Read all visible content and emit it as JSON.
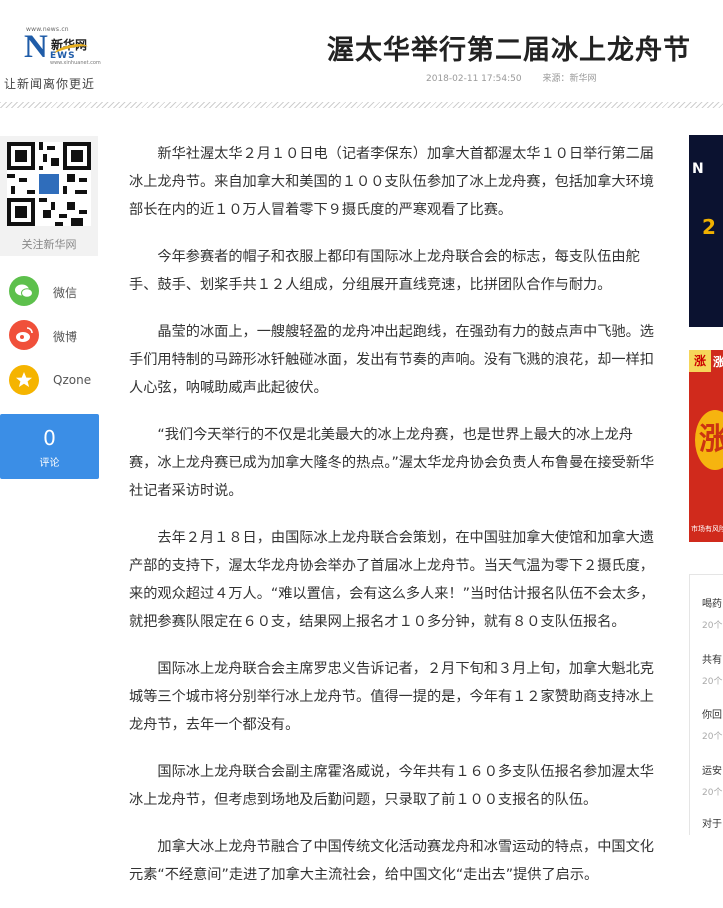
{
  "header": {
    "logo_url_text": "www.news.cn",
    "logo_brand": "新华网",
    "logo_letter": "N",
    "logo_ews": "EWS",
    "logo_url_small": "www.xinhuanet.com",
    "slogan": "让新闻离你更近",
    "title": "渥太华举行第二届冰上龙舟节",
    "datetime": "2018-02-11 17:54:50",
    "source": "来源：新华网"
  },
  "sidebar": {
    "qr_label": "关注新华网",
    "share": [
      {
        "label": "微信",
        "icon": "wechat-icon",
        "color": "#5dc04c"
      },
      {
        "label": "微博",
        "icon": "weibo-icon",
        "color": "#f0503a"
      },
      {
        "label": "Qzone",
        "icon": "qzone-icon",
        "color": "#f5b400"
      }
    ],
    "comment_count": "0",
    "comment_label": "评论"
  },
  "article": {
    "paragraphs": [
      "新华社渥太华２月１０日电（记者李保东）加拿大首都渥太华１０日举行第二届冰上龙舟节。来自加拿大和美国的１００支队伍参加了冰上龙舟赛，包括加拿大环境部长在内的近１０万人冒着零下９摄氏度的严寒观看了比赛。",
      "今年参赛者的帽子和衣服上都印有国际冰上龙舟联合会的标志，每支队伍由舵手、鼓手、划桨手共１２人组成，分组展开直线竞速，比拼团队合作与耐力。",
      "晶莹的冰面上，一艘艘轻盈的龙舟冲出起跑线，在强劲有力的鼓点声中飞驰。选手们用特制的马蹄形冰钎触碰冰面，发出有节奏的声响。没有飞溅的浪花，却一样扣人心弦，呐喊助威声此起彼伏。",
      "“我们今天举行的不仅是北美最大的冰上龙舟赛，也是世界上最大的冰上龙舟赛，冰上龙舟赛已成为加拿大隆冬的热点。”渥太华龙舟协会负责人布鲁曼在接受新华社记者采访时说。",
      "去年２月１８日，由国际冰上龙舟联合会策划，在中国驻加拿大使馆和加拿大遗产部的支持下，渥太华龙舟协会举办了首届冰上龙舟节。当天气温为零下２摄氏度，来的观众超过４万人。“难以置信，会有这么多人来！”当时估计报名队伍不会太多，就把参赛队限定在６０支，结果网上报名才１０多分钟，就有８０支队伍报名。",
      "国际冰上龙舟联合会主席罗忠义告诉记者，２月下旬和３月上旬，加拿大魁北克城等三个城市将分别举行冰上龙舟节。值得一提的是，今年有１２家赞助商支持冰上龙舟节，去年一个都没有。",
      "国际冰上龙舟联合会副主席霍洛威说，今年共有１６０多支队伍报名参加渥太华冰上龙舟节，但考虑到场地及后勤问题，只录取了前１００支报名的队伍。",
      "加拿大冰上龙舟节融合了中国传统文化活动赛龙舟和冰雪运动的特点，中国文化元素“不经意间”走进了加拿大主流社会，给中国文化“走出去”提供了启示。"
    ]
  },
  "ads": {
    "ad1_mark": "N",
    "ad1_text": "2",
    "ad2_tag": "涨",
    "ad2_tag2": "涨",
    "ad2_coin": "涨",
    "ad2_foot": "市场有风险"
  },
  "rank": {
    "items": [
      {
        "title": "喝药",
        "sub": "20个"
      },
      {
        "title": "共有",
        "sub": "20个"
      },
      {
        "title": "你回",
        "sub": "20个"
      },
      {
        "title": "运安",
        "sub": "20个"
      },
      {
        "title": "对于",
        "sub": ""
      }
    ]
  }
}
